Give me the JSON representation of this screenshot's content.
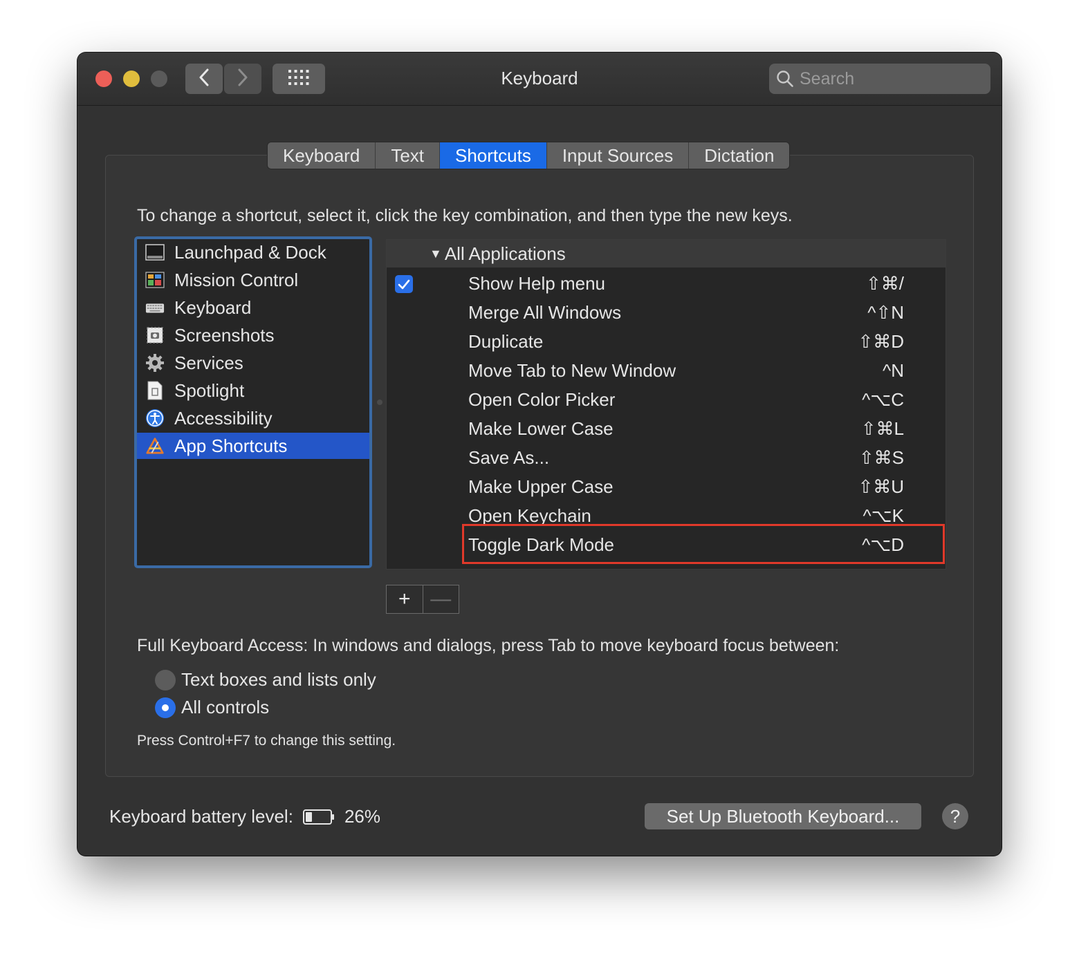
{
  "window": {
    "title": "Keyboard"
  },
  "search": {
    "placeholder": "Search"
  },
  "tabs": [
    {
      "label": "Keyboard"
    },
    {
      "label": "Text"
    },
    {
      "label": "Shortcuts",
      "active": true
    },
    {
      "label": "Input Sources"
    },
    {
      "label": "Dictation"
    }
  ],
  "instructions": "To change a shortcut, select it, click the key combination, and then type the new keys.",
  "categories": [
    {
      "label": "Launchpad & Dock",
      "icon": "launchpad-dock-icon"
    },
    {
      "label": "Mission Control",
      "icon": "mission-control-icon"
    },
    {
      "label": "Keyboard",
      "icon": "keyboard-icon"
    },
    {
      "label": "Screenshots",
      "icon": "screenshots-icon"
    },
    {
      "label": "Services",
      "icon": "gear-icon"
    },
    {
      "label": "Spotlight",
      "icon": "spotlight-icon"
    },
    {
      "label": "Accessibility",
      "icon": "accessibility-icon"
    },
    {
      "label": "App Shortcuts",
      "icon": "app-store-icon",
      "selected": true
    }
  ],
  "shortcuts": {
    "group_label": "All Applications",
    "group_expanded": true,
    "group_checked": true,
    "items": [
      {
        "name": "Show Help menu",
        "keys": "⇧⌘/"
      },
      {
        "name": "Merge All Windows",
        "keys": "^⇧N"
      },
      {
        "name": "Duplicate",
        "keys": "⇧⌘D"
      },
      {
        "name": "Move Tab to New Window",
        "keys": "^N"
      },
      {
        "name": "Open Color Picker",
        "keys": "^⌥C"
      },
      {
        "name": "Make Lower Case",
        "keys": "⇧⌘L"
      },
      {
        "name": "Save As...",
        "keys": "⇧⌘S"
      },
      {
        "name": "Make Upper Case",
        "keys": "⇧⌘U"
      },
      {
        "name": "Open Keychain",
        "keys": "^⌥K"
      },
      {
        "name": "Toggle Dark Mode",
        "keys": "^⌥D",
        "highlighted": true
      }
    ]
  },
  "list_buttons": {
    "add": "+",
    "remove": "—"
  },
  "full_keyboard_access": {
    "label": "Full Keyboard Access: In windows and dialogs, press Tab to move keyboard focus between:",
    "options": [
      {
        "label": "Text boxes and lists only",
        "selected": false
      },
      {
        "label": "All controls",
        "selected": true
      }
    ],
    "note": "Press Control+F7 to change this setting."
  },
  "battery": {
    "label": "Keyboard battery level:",
    "value": "26%",
    "level": 0.26
  },
  "bluetooth_button": "Set Up Bluetooth Keyboard...",
  "help_button": "?",
  "colors": {
    "accent": "#1a6ae6",
    "selection": "#2456c8",
    "highlight_border": "#e0392a",
    "close": "#ec5f58",
    "minimize": "#e0bd3d"
  }
}
